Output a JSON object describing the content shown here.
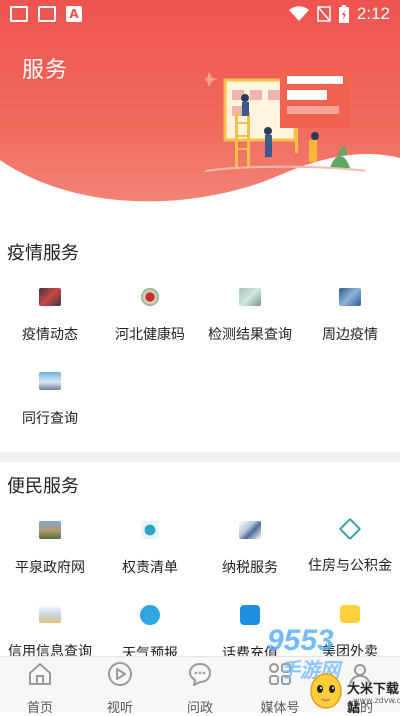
{
  "status_bar": {
    "time": "2:12",
    "left_badge": "A"
  },
  "header": {
    "title": "服务"
  },
  "sections": [
    {
      "title": "疫情服务",
      "items": [
        {
          "label": "疫情动态",
          "icon": "news-icon"
        },
        {
          "label": "河北健康码",
          "icon": "health-code-icon"
        },
        {
          "label": "检测结果查询",
          "icon": "test-result-icon"
        },
        {
          "label": "周边疫情",
          "icon": "nearby-map-icon"
        },
        {
          "label": "同行查询",
          "icon": "train-icon"
        }
      ]
    },
    {
      "title": "便民服务",
      "items": [
        {
          "label": "平泉政府网",
          "icon": "government-building-icon"
        },
        {
          "label": "权责清单",
          "icon": "list-icon"
        },
        {
          "label": "纳税服务",
          "icon": "tax-icon"
        },
        {
          "label": "住房与公积金",
          "icon": "housing-icon"
        },
        {
          "label": "信用信息查询",
          "icon": "credit-icon"
        },
        {
          "label": "天气预报",
          "icon": "weather-icon"
        },
        {
          "label": "话费充值",
          "icon": "phone-recharge-icon"
        },
        {
          "label": "美团外卖",
          "icon": "meituan-icon"
        }
      ]
    }
  ],
  "bottom_nav": [
    {
      "label": "首页",
      "icon": "home-icon"
    },
    {
      "label": "视听",
      "icon": "play-icon"
    },
    {
      "label": "问政",
      "icon": "chat-icon"
    },
    {
      "label": "媒体号",
      "icon": "media-icon"
    },
    {
      "label": "我的",
      "icon": "user-icon"
    }
  ],
  "watermark": {
    "brand": "9553",
    "sub": "手游网",
    "site": "大米下载站",
    "url": "www.zdvw.com"
  },
  "colors": {
    "primary": "#ef5350",
    "accent_blue": "#3aa0ff"
  }
}
